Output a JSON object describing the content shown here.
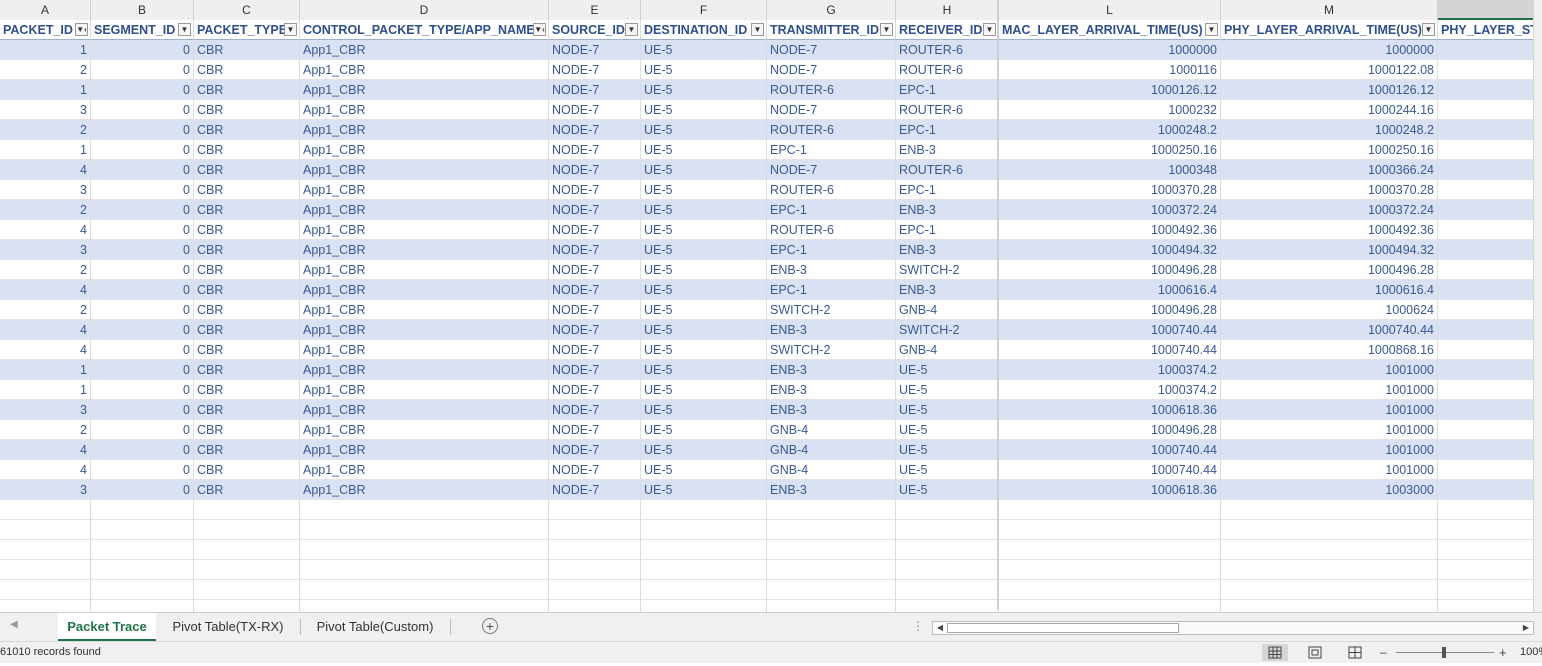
{
  "columns": [
    {
      "letter": "A",
      "header": "PACKET_ID",
      "filter": "sort-filter"
    },
    {
      "letter": "B",
      "header": "SEGMENT_ID",
      "filter": "dropdown"
    },
    {
      "letter": "C",
      "header": "PACKET_TYPE",
      "filter": "dropdown"
    },
    {
      "letter": "D",
      "header": "CONTROL_PACKET_TYPE/APP_NAME",
      "filter": "sort-filter"
    },
    {
      "letter": "E",
      "header": "SOURCE_ID",
      "filter": "dropdown"
    },
    {
      "letter": "F",
      "header": "DESTINATION_ID",
      "filter": "dropdown"
    },
    {
      "letter": "G",
      "header": "TRANSMITTER_ID",
      "filter": "dropdown"
    },
    {
      "letter": "H",
      "header": "RECEIVER_ID",
      "filter": "dropdown"
    },
    {
      "letter": "L",
      "header": "MAC_LAYER_ARRIVAL_TIME(US)",
      "filter": "dropdown"
    },
    {
      "letter": "M",
      "header": "PHY_LAYER_ARRIVAL_TIME(US)",
      "filter": "dropdown"
    },
    {
      "letter": "",
      "header": "PHY_LAYER_ST",
      "filter": ""
    }
  ],
  "rows": [
    [
      "1",
      "0",
      "CBR",
      "App1_CBR",
      "NODE-7",
      "UE-5",
      "NODE-7",
      "ROUTER-6",
      "1000000",
      "1000000"
    ],
    [
      "2",
      "0",
      "CBR",
      "App1_CBR",
      "NODE-7",
      "UE-5",
      "NODE-7",
      "ROUTER-6",
      "1000116",
      "1000122.08"
    ],
    [
      "1",
      "0",
      "CBR",
      "App1_CBR",
      "NODE-7",
      "UE-5",
      "ROUTER-6",
      "EPC-1",
      "1000126.12",
      "1000126.12"
    ],
    [
      "3",
      "0",
      "CBR",
      "App1_CBR",
      "NODE-7",
      "UE-5",
      "NODE-7",
      "ROUTER-6",
      "1000232",
      "1000244.16"
    ],
    [
      "2",
      "0",
      "CBR",
      "App1_CBR",
      "NODE-7",
      "UE-5",
      "ROUTER-6",
      "EPC-1",
      "1000248.2",
      "1000248.2"
    ],
    [
      "1",
      "0",
      "CBR",
      "App1_CBR",
      "NODE-7",
      "UE-5",
      "EPC-1",
      "ENB-3",
      "1000250.16",
      "1000250.16"
    ],
    [
      "4",
      "0",
      "CBR",
      "App1_CBR",
      "NODE-7",
      "UE-5",
      "NODE-7",
      "ROUTER-6",
      "1000348",
      "1000366.24"
    ],
    [
      "3",
      "0",
      "CBR",
      "App1_CBR",
      "NODE-7",
      "UE-5",
      "ROUTER-6",
      "EPC-1",
      "1000370.28",
      "1000370.28"
    ],
    [
      "2",
      "0",
      "CBR",
      "App1_CBR",
      "NODE-7",
      "UE-5",
      "EPC-1",
      "ENB-3",
      "1000372.24",
      "1000372.24"
    ],
    [
      "4",
      "0",
      "CBR",
      "App1_CBR",
      "NODE-7",
      "UE-5",
      "ROUTER-6",
      "EPC-1",
      "1000492.36",
      "1000492.36"
    ],
    [
      "3",
      "0",
      "CBR",
      "App1_CBR",
      "NODE-7",
      "UE-5",
      "EPC-1",
      "ENB-3",
      "1000494.32",
      "1000494.32"
    ],
    [
      "2",
      "0",
      "CBR",
      "App1_CBR",
      "NODE-7",
      "UE-5",
      "ENB-3",
      "SWITCH-2",
      "1000496.28",
      "1000496.28"
    ],
    [
      "4",
      "0",
      "CBR",
      "App1_CBR",
      "NODE-7",
      "UE-5",
      "EPC-1",
      "ENB-3",
      "1000616.4",
      "1000616.4"
    ],
    [
      "2",
      "0",
      "CBR",
      "App1_CBR",
      "NODE-7",
      "UE-5",
      "SWITCH-2",
      "GNB-4",
      "1000496.28",
      "1000624"
    ],
    [
      "4",
      "0",
      "CBR",
      "App1_CBR",
      "NODE-7",
      "UE-5",
      "ENB-3",
      "SWITCH-2",
      "1000740.44",
      "1000740.44"
    ],
    [
      "4",
      "0",
      "CBR",
      "App1_CBR",
      "NODE-7",
      "UE-5",
      "SWITCH-2",
      "GNB-4",
      "1000740.44",
      "1000868.16"
    ],
    [
      "1",
      "0",
      "CBR",
      "App1_CBR",
      "NODE-7",
      "UE-5",
      "ENB-3",
      "UE-5",
      "1000374.2",
      "1001000"
    ],
    [
      "1",
      "0",
      "CBR",
      "App1_CBR",
      "NODE-7",
      "UE-5",
      "ENB-3",
      "UE-5",
      "1000374.2",
      "1001000"
    ],
    [
      "3",
      "0",
      "CBR",
      "App1_CBR",
      "NODE-7",
      "UE-5",
      "ENB-3",
      "UE-5",
      "1000618.36",
      "1001000"
    ],
    [
      "2",
      "0",
      "CBR",
      "App1_CBR",
      "NODE-7",
      "UE-5",
      "GNB-4",
      "UE-5",
      "1000496.28",
      "1001000"
    ],
    [
      "4",
      "0",
      "CBR",
      "App1_CBR",
      "NODE-7",
      "UE-5",
      "GNB-4",
      "UE-5",
      "1000740.44",
      "1001000"
    ],
    [
      "4",
      "0",
      "CBR",
      "App1_CBR",
      "NODE-7",
      "UE-5",
      "GNB-4",
      "UE-5",
      "1000740.44",
      "1001000"
    ],
    [
      "3",
      "0",
      "CBR",
      "App1_CBR",
      "NODE-7",
      "UE-5",
      "ENB-3",
      "UE-5",
      "1000618.36",
      "1003000"
    ]
  ],
  "tabs": [
    {
      "label": "Packet Trace",
      "active": true
    },
    {
      "label": "Pivot Table(TX-RX)",
      "active": false
    },
    {
      "label": "Pivot Table(Custom)",
      "active": false
    }
  ],
  "status": {
    "records": "61010 records found",
    "zoom": "100%"
  },
  "colors": {
    "accent": "#217346",
    "band": "#d9e1f2",
    "text": "#3a5a95"
  }
}
